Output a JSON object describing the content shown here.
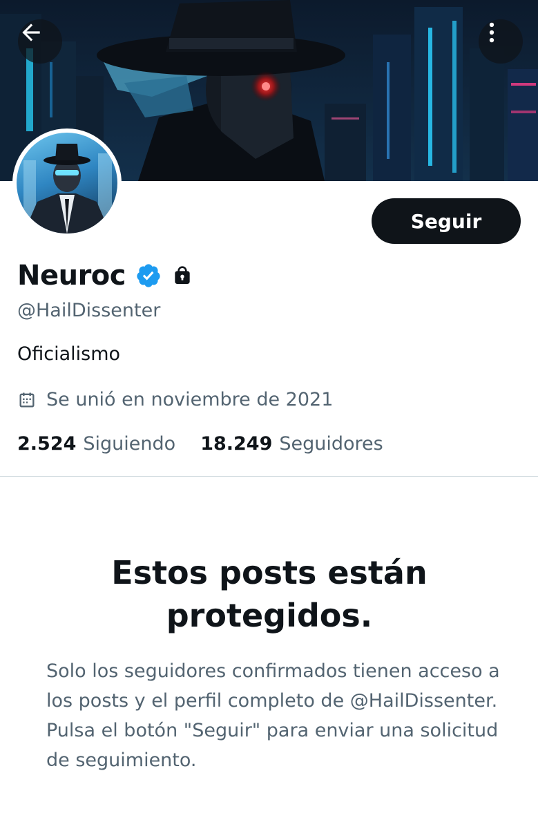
{
  "header": {
    "back_icon": "arrow-left-icon",
    "more_icon": "more-vertical-icon"
  },
  "profile": {
    "display_name": "Neuroc",
    "verified_icon": "verified-badge-icon",
    "verified_color": "#1d9bf0",
    "lock_icon": "lock-icon",
    "handle": "@HailDissenter",
    "bio": "Oficialismo",
    "joined_icon": "calendar-icon",
    "joined": "Se unió en noviembre de 2021",
    "following_count": "2.524",
    "following_label": "Siguiendo",
    "followers_count": "18.249",
    "followers_label": "Seguidores"
  },
  "actions": {
    "follow_label": "Seguir"
  },
  "protected": {
    "title": "Estos posts están protegidos.",
    "description": "Solo los seguidores confirmados tienen acceso a los posts y el perfil completo de @HailDissenter. Pulsa el botón \"Seguir\" para enviar una solicitud de seguimiento."
  },
  "colors": {
    "text_primary": "#0f1419",
    "text_secondary": "#536471",
    "button_bg": "#0f1419",
    "divider": "#cfd9de"
  }
}
